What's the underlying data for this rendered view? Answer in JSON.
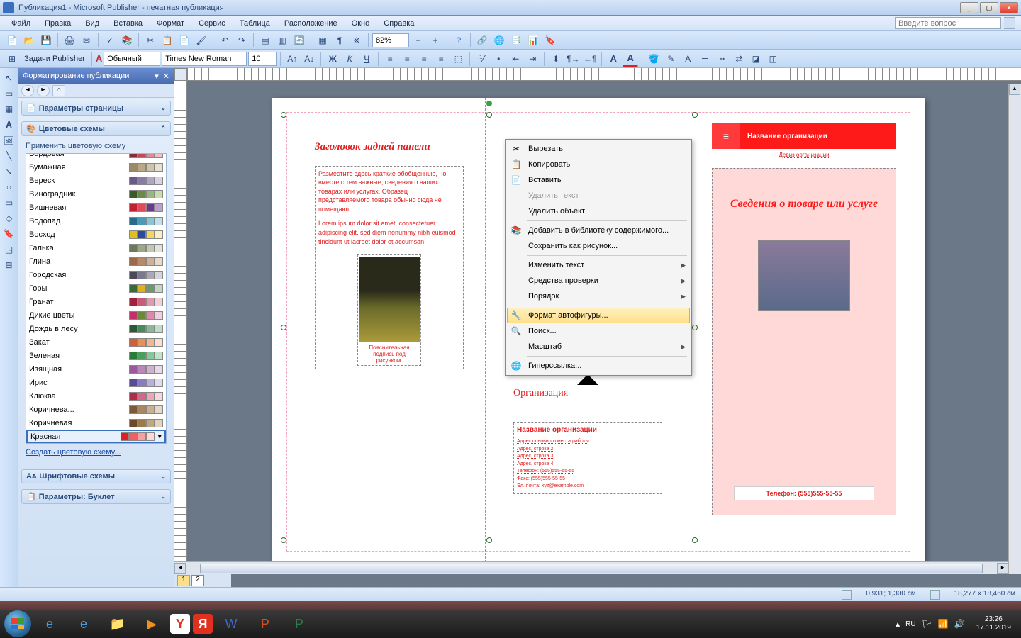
{
  "titlebar": {
    "title": "Публикация1 - Microsoft Publisher - печатная публикация"
  },
  "menubar": {
    "items": [
      "Файл",
      "Правка",
      "Вид",
      "Вставка",
      "Формат",
      "Сервис",
      "Таблица",
      "Расположение",
      "Окно",
      "Справка"
    ],
    "help_placeholder": "Введите вопрос"
  },
  "toolbar1": {
    "zoom": "82%"
  },
  "toolbar2": {
    "tasks_label": "Задачи Publisher",
    "style": "Обычный",
    "font": "Times New Roman",
    "size": "10"
  },
  "taskpane": {
    "title": "Форматирование публикации",
    "sections": {
      "page_params": "Параметры страницы",
      "color_schemes": "Цветовые схемы",
      "font_schemes": "Шрифтовые схемы",
      "booklet_params": "Параметры: Буклет"
    },
    "apply_label": "Применить цветовую схему",
    "create_link": "Создать цветовую схему...",
    "schemes": [
      {
        "name": "Бордовая",
        "c": [
          "#8a2a3a",
          "#c04a5a",
          "#e08a9a",
          "#f0c0c8"
        ]
      },
      {
        "name": "Бумажная",
        "c": [
          "#9a8a6a",
          "#b8a888",
          "#d0c4a8",
          "#e8e0d0"
        ]
      },
      {
        "name": "Вереск",
        "c": [
          "#6a5a8a",
          "#8a7aa8",
          "#b0a4c8",
          "#d8d0e4"
        ]
      },
      {
        "name": "Виноградник",
        "c": [
          "#3a5a2a",
          "#6a8a4a",
          "#9ab87a",
          "#c8dcb0"
        ]
      },
      {
        "name": "Вишневая",
        "c": [
          "#c02030",
          "#e04a5a",
          "#6a3a8a",
          "#b8a0d0"
        ]
      },
      {
        "name": "Водопад",
        "c": [
          "#2a6a8a",
          "#4a9ab8",
          "#8ac4d8",
          "#c0e0ec"
        ]
      },
      {
        "name": "Восход",
        "c": [
          "#e0c020",
          "#2a4aa0",
          "#f0d860",
          "#f8f0c0"
        ]
      },
      {
        "name": "Галька",
        "c": [
          "#6a7a5a",
          "#9aa888",
          "#c0c8b0",
          "#e0e4d8"
        ]
      },
      {
        "name": "Глина",
        "c": [
          "#9a6a4a",
          "#b88a6a",
          "#d0b098",
          "#e8d8c8"
        ]
      },
      {
        "name": "Городская",
        "c": [
          "#4a4a5a",
          "#7a7a8a",
          "#a8a8b8",
          "#d4d4dc"
        ]
      },
      {
        "name": "Горы",
        "c": [
          "#3a6a3a",
          "#e0b020",
          "#6a9a6a",
          "#c0d8c0"
        ]
      },
      {
        "name": "Гранат",
        "c": [
          "#a02040",
          "#c85a7a",
          "#e09ab0",
          "#f0d0d8"
        ]
      },
      {
        "name": "Дикие цветы",
        "c": [
          "#c0306a",
          "#6a8a3a",
          "#e088a8",
          "#f0d0e0"
        ]
      },
      {
        "name": "Дождь в лесу",
        "c": [
          "#2a5a3a",
          "#4a8a5a",
          "#88b898",
          "#c0dcc8"
        ]
      },
      {
        "name": "Закат",
        "c": [
          "#d0603a",
          "#e8905a",
          "#f0b890",
          "#f8e0d0"
        ]
      },
      {
        "name": "Зеленая",
        "c": [
          "#2a7a3a",
          "#4aa05a",
          "#88c898",
          "#c0e4c8"
        ]
      },
      {
        "name": "Изящная",
        "c": [
          "#9a5a9a",
          "#b888b8",
          "#d0b0d0",
          "#e8d8e8"
        ]
      },
      {
        "name": "Ирис",
        "c": [
          "#5a4a9a",
          "#8a7ac0",
          "#b8b0dc",
          "#e0dcf0"
        ]
      },
      {
        "name": "Клюква",
        "c": [
          "#b02a4a",
          "#d06a8a",
          "#e8a8b8",
          "#f4d8e0"
        ]
      },
      {
        "name": "Коричнева...",
        "c": [
          "#7a5a3a",
          "#a88860",
          "#c8b090",
          "#e4d8c8"
        ]
      },
      {
        "name": "Коричневая",
        "c": [
          "#6a4a2a",
          "#9a7a4a",
          "#c0a880",
          "#e0d4c0"
        ]
      },
      {
        "name": "Красная",
        "c": [
          "#e02020",
          "#f06060",
          "#f8a0a0",
          "#fcd8d8"
        ],
        "selected": true
      }
    ]
  },
  "document": {
    "panel1": {
      "heading": "Заголовок задней панели",
      "para1": "Разместите здесь краткие обобщенные, но вместе с тем важные, сведения о ваших товарах или услугах. Образец представляемого товара обычно сюда не помещают.",
      "para2": "Lorem ipsum dolor sit amet, consectetuer adipiscing elit, sed diem nonummy nibh euismod tincidunt ut lacreet dolor et accumsan.",
      "caption": "Пояснительная подпись под рисунком."
    },
    "panel2": {
      "org_label": "Организация",
      "name": "Название организации",
      "addr1": "Адрес основного места работы",
      "addr2": "Адрес, строка 2",
      "addr3": "Адрес, строка 3",
      "addr4": "Адрес, строка 4",
      "phone": "Телефон: (555)555-55-55",
      "fax": "Факс: (555)555-55-55",
      "email": "Эл. почта: xyz@example.com"
    },
    "panel3": {
      "banner": "Название организации",
      "motto": "Девиз организации",
      "heading": "Сведения о товаре или услуге",
      "phone": "Телефон: (555)555-55-55"
    }
  },
  "context_menu": {
    "items": [
      {
        "icon": "✂",
        "label": "Вырезать"
      },
      {
        "icon": "📋",
        "label": "Копировать"
      },
      {
        "icon": "📄",
        "label": "Вставить"
      },
      {
        "icon": "",
        "label": "Удалить текст",
        "disabled": true
      },
      {
        "icon": "",
        "label": "Удалить объект"
      },
      {
        "sep": true
      },
      {
        "icon": "📚",
        "label": "Добавить в библиотеку содержимого..."
      },
      {
        "icon": "",
        "label": "Сохранить как рисунок..."
      },
      {
        "sep": true
      },
      {
        "icon": "",
        "label": "Изменить текст",
        "sub": true
      },
      {
        "icon": "",
        "label": "Средства проверки",
        "sub": true
      },
      {
        "icon": "",
        "label": "Порядок",
        "sub": true
      },
      {
        "sep": true
      },
      {
        "icon": "🔧",
        "label": "Формат автофигуры...",
        "highlighted": true
      },
      {
        "icon": "🔍",
        "label": "Поиск..."
      },
      {
        "icon": "",
        "label": "Масштаб",
        "sub": true
      },
      {
        "sep": true
      },
      {
        "icon": "🌐",
        "label": "Гиперссылка..."
      }
    ]
  },
  "statusbar": {
    "pos": "0,931; 1,300 см",
    "size": "18,277 x 18,460 см"
  },
  "page_nav": {
    "pages": [
      "1",
      "2"
    ],
    "active": 0
  },
  "tray": {
    "lang": "RU",
    "time": "23:26",
    "date": "17.11.2019"
  }
}
